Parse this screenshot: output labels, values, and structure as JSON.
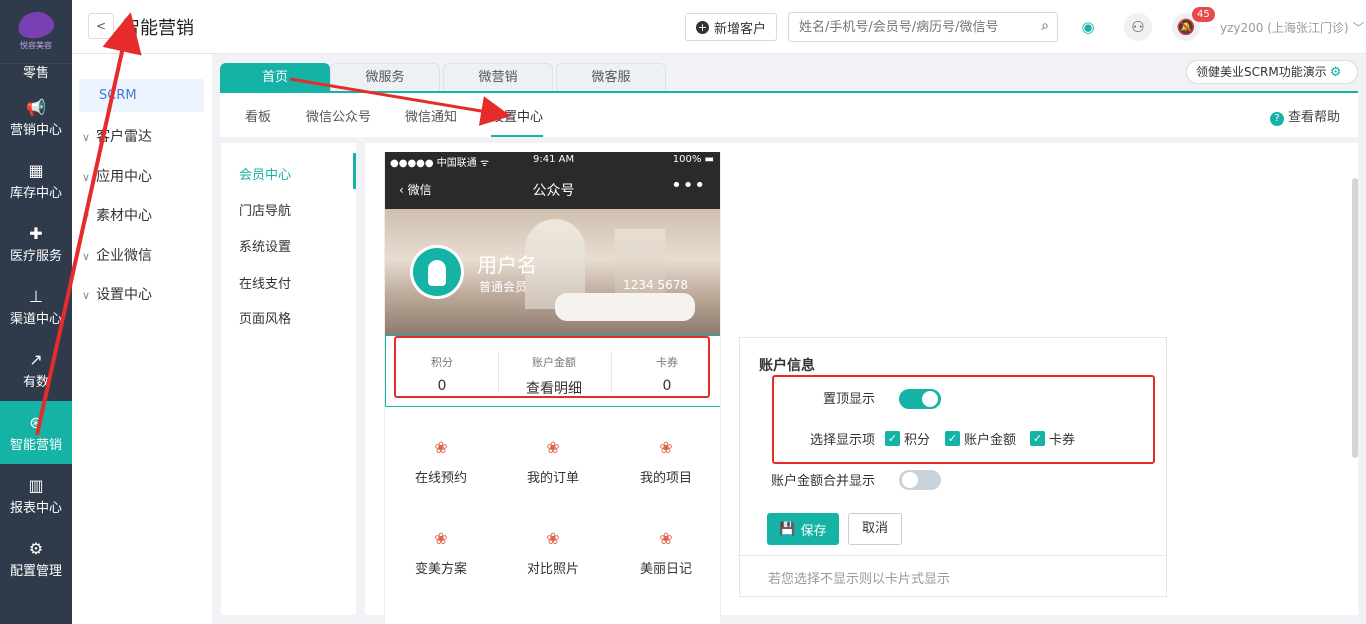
{
  "app": {
    "brand_name": "悦容美容",
    "title": "智能营销"
  },
  "nav": [
    {
      "label": "零售",
      "icon": "retail-icon"
    },
    {
      "label": "营销中心",
      "icon": "megaphone-icon"
    },
    {
      "label": "库存中心",
      "icon": "grid-icon"
    },
    {
      "label": "医疗服务",
      "icon": "medical-kit-icon"
    },
    {
      "label": "渠道中心",
      "icon": "hierarchy-icon"
    },
    {
      "label": "有数",
      "icon": "trend-chart-icon"
    },
    {
      "label": "智能营销",
      "icon": "compass-icon",
      "active": true
    },
    {
      "label": "报表中心",
      "icon": "bar-chart-icon"
    },
    {
      "label": "配置管理",
      "icon": "gear-icon"
    }
  ],
  "topbar": {
    "new_customer_label": "新增客户",
    "search_placeholder": "姓名/手机号/会员号/病历号/微信号",
    "notification_count": "45",
    "user_label": "yzy200 (上海张江门诊) ﹀"
  },
  "submenu": {
    "active_label": "SCRM",
    "items": [
      "客户雷达",
      "应用中心",
      "素材中心",
      "企业微信",
      "设置中心"
    ]
  },
  "tabs": [
    "首页",
    "微服务",
    "微营销",
    "微客服"
  ],
  "demo_label": "领健美业SCRM功能演示",
  "subtabs": [
    "看板",
    "微信公众号",
    "微信通知",
    "设置中心"
  ],
  "help_label": "查看帮助",
  "left_menu": [
    "会员中心",
    "门店导航",
    "系统设置",
    "在线支付",
    "页面风格"
  ],
  "phone": {
    "status_left": "●●●●● 中国联通 ᯤ",
    "status_time": "9:41 AM",
    "status_battery": "100% ▬",
    "back_label": "微信",
    "header_title": "公众号",
    "more": "•••",
    "user_name": "用户名",
    "user_level": "普通会员",
    "user_number": "1234 5678",
    "stats": [
      {
        "label": "积分",
        "value": "0"
      },
      {
        "label": "账户金额",
        "value": "查看明细"
      },
      {
        "label": "卡券",
        "value": "0"
      }
    ],
    "services": [
      "在线预约",
      "我的订单",
      "我的项目",
      "变美方案",
      "对比照片",
      "美丽日记"
    ]
  },
  "settings": {
    "title": "账户信息",
    "pin_label": "置顶显示",
    "pin_on": true,
    "select_label": "选择显示项",
    "options": [
      "积分",
      "账户金额",
      "卡券"
    ],
    "merge_label": "账户金额合并显示",
    "merge_on": false,
    "save_label": "保存",
    "cancel_label": "取消",
    "note": "若您选择不显示则以卡片式显示"
  },
  "colors": {
    "accent": "#14b3a5",
    "sidebar": "#2f3b4a",
    "annotation_red": "#e62b2b"
  }
}
